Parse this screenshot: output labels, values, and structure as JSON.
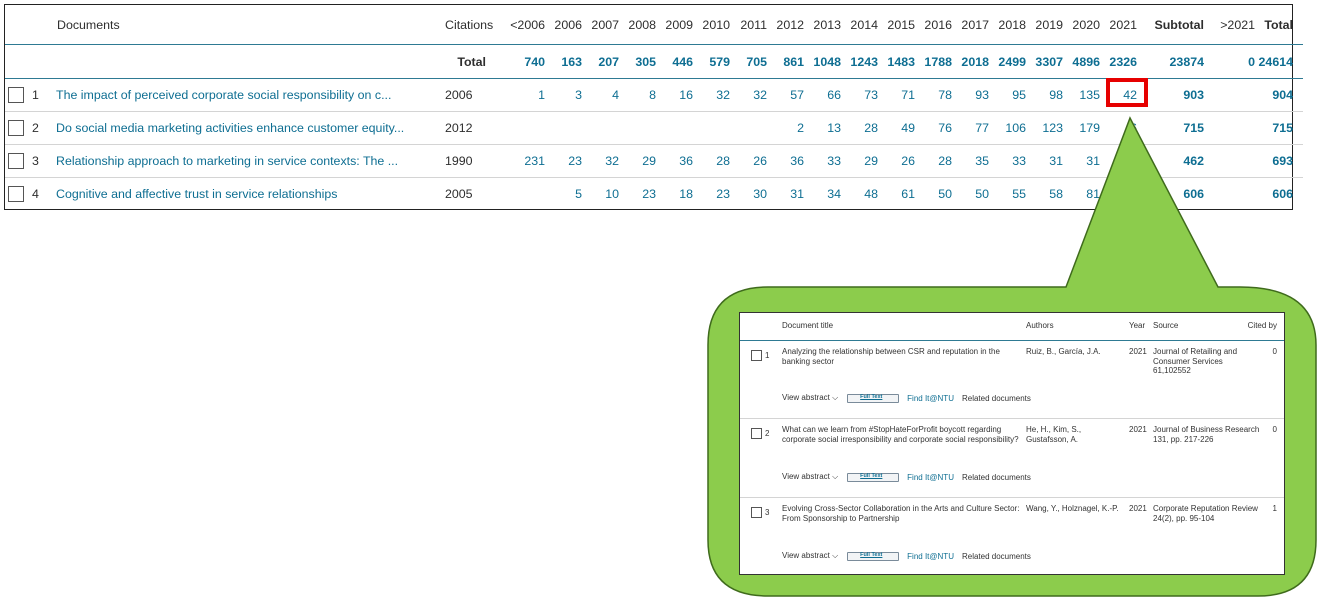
{
  "table": {
    "headers": {
      "documents": "Documents",
      "citations": "Citations",
      "years": [
        "<2006",
        "2006",
        "2007",
        "2008",
        "2009",
        "2010",
        "2011",
        "2012",
        "2013",
        "2014",
        "2015",
        "2016",
        "2017",
        "2018",
        "2019",
        "2020",
        "2021"
      ],
      "subtotal": "Subtotal",
      "after": ">2021",
      "total": "Total"
    },
    "totals": {
      "label": "Total",
      "values": [
        "740",
        "163",
        "207",
        "305",
        "446",
        "579",
        "705",
        "861",
        "1048",
        "1243",
        "1483",
        "1788",
        "2018",
        "2499",
        "3307",
        "4896",
        "2326"
      ],
      "subtotal": "23874",
      "after": "0",
      "total": "24614"
    },
    "rows": [
      {
        "num": "1",
        "title": "The impact of perceived corporate social responsibility on c...",
        "year": "2006",
        "values": [
          "1",
          "3",
          "4",
          "8",
          "16",
          "32",
          "32",
          "57",
          "66",
          "73",
          "71",
          "78",
          "93",
          "95",
          "98",
          "135",
          "42"
        ],
        "subtotal": "903",
        "after": "",
        "total": "904"
      },
      {
        "num": "2",
        "title": "Do social media marketing activities enhance customer equity...",
        "year": "2012",
        "values": [
          "",
          "",
          "",
          "",
          "",
          "",
          "",
          "2",
          "13",
          "28",
          "49",
          "76",
          "77",
          "106",
          "123",
          "179",
          "6"
        ],
        "subtotal": "715",
        "after": "",
        "total": "715"
      },
      {
        "num": "3",
        "title": "Relationship approach to marketing in service contexts: The ...",
        "year": "1990",
        "values": [
          "231",
          "23",
          "32",
          "29",
          "36",
          "28",
          "26",
          "36",
          "33",
          "29",
          "26",
          "28",
          "35",
          "33",
          "31",
          "31",
          ""
        ],
        "subtotal": "462",
        "after": "",
        "total": "693"
      },
      {
        "num": "4",
        "title": "Cognitive and affective trust in service relationships",
        "year": "2005",
        "values": [
          "",
          "5",
          "10",
          "23",
          "18",
          "23",
          "30",
          "31",
          "34",
          "48",
          "61",
          "50",
          "50",
          "55",
          "58",
          "81",
          ""
        ],
        "subtotal": "606",
        "after": "",
        "total": "606"
      }
    ]
  },
  "results": {
    "headers": {
      "title": "Document title",
      "authors": "Authors",
      "year": "Year",
      "source": "Source",
      "cited": "Cited by"
    },
    "actions": {
      "view_abstract": "View abstract ⌵",
      "full_text": "Full Text",
      "find_it": "Find It@NTU",
      "related": "Related documents"
    },
    "items": [
      {
        "num": "1",
        "title": "Analyzing the relationship between CSR and reputation in the banking sector",
        "authors": "Ruiz, B., García, J.A.",
        "year": "2021",
        "source_line1": "Journal of Retailing and Consumer Services",
        "source_line2": "61,102552",
        "cited": "0"
      },
      {
        "num": "2",
        "title": "What can we learn from #StopHateForProfit boycott regarding corporate social irresponsibility and corporate social responsibility?",
        "authors": "He, H., Kim, S., Gustafsson, A.",
        "year": "2021",
        "source_line1": "Journal of Business Research",
        "source_line2": "131, pp. 217-226",
        "cited": "0"
      },
      {
        "num": "3",
        "title": "Evolving Cross-Sector Collaboration in the Arts and Culture Sector: From Sponsorship to Partnership",
        "authors": "Wang, Y., Holznagel, K.-P.",
        "year": "2021",
        "source_line1": "Corporate Reputation Review",
        "source_line2": "24(2), pp. 95-104",
        "cited": "1"
      }
    ]
  },
  "colors": {
    "link": "#0e6e92",
    "highlight": "#e60000",
    "callout_fill": "#8ccc4c",
    "callout_border": "#3f6b1c"
  }
}
